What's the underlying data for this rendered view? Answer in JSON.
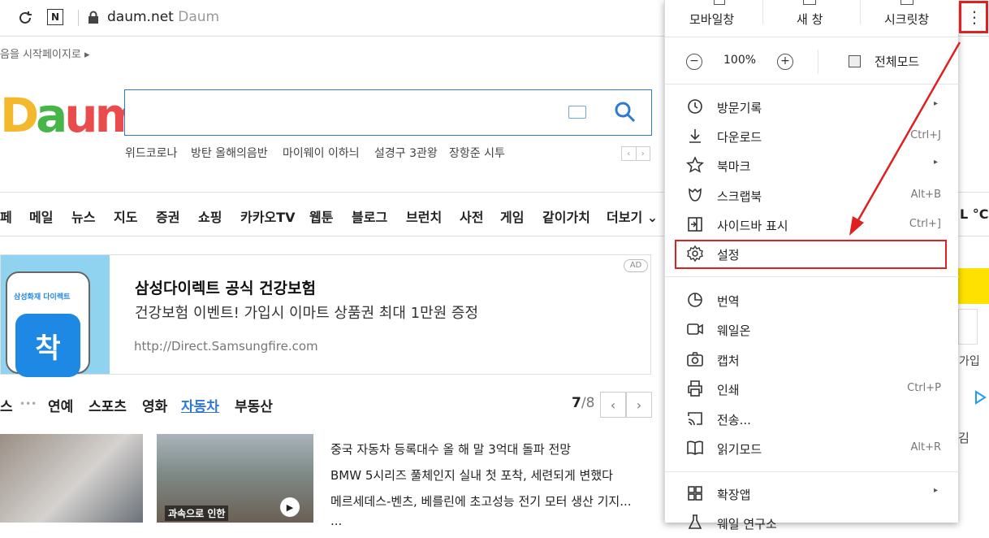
{
  "browser": {
    "domain": "daum.net",
    "site_name": "Daum",
    "reload_icon": "reload-icon",
    "n_icon": "N"
  },
  "daum": {
    "start_page_link": "음을 시작페이지로 ▸",
    "logo_text": [
      "D",
      "a",
      "u",
      "m"
    ],
    "keywords": [
      "위드코로나",
      "방탄 올해의음반",
      "마이웨이 이하늬",
      "설경구 3관왕",
      "장항준 시투"
    ],
    "paging": [
      "‹",
      "›"
    ],
    "nav": [
      "페",
      "메일",
      "뉴스",
      "지도",
      "증권",
      "쇼핑",
      "카카오TV",
      "웹툰",
      "블로그",
      "브런치",
      "사전",
      "게임",
      "같이가치",
      "더보기 ⌄"
    ],
    "weather": "L °C",
    "ad": {
      "badge_brand": "삼성화재 다이렉트",
      "badge": "착",
      "title": "삼성다이렉트 공식 건강보험",
      "subtitle": "건강보험 이벤트! 가입시 이마트 상품권 최대 1만원 증정",
      "url": "http://Direct.Samsungfire.com",
      "tag": "AD"
    },
    "tabs": [
      "스",
      "연예",
      "스포츠",
      "영화",
      "자동차",
      "부동산"
    ],
    "more_dots": "•••",
    "active_tab": "자동차",
    "counter_current": "7",
    "counter_total": "/8",
    "prev": "‹",
    "next": "›",
    "thumb_caption": "과속으로 인한",
    "news": [
      "중국 자동차 등록대수 올 해 말 3억대 돌파 전망",
      "BMW 5시리즈 풀체인지 실내 첫 포착, 세련되게 변했다",
      "메르세데스-벤츠, 베를린에 초고성능 전기 모터 생산 기지...",
      "..."
    ],
    "right_strip": [
      "가입",
      "김"
    ]
  },
  "menu": {
    "top": [
      "모바일창",
      "새 창",
      "시크릿창"
    ],
    "zoom": {
      "minus": "−",
      "value": "100%",
      "plus": "+",
      "fullscreen": "전체모드"
    },
    "items": [
      {
        "label": "방문기록",
        "shortcut": "",
        "arrow": "▸",
        "icon": "history-icon"
      },
      {
        "label": "다운로드",
        "shortcut": "Ctrl+J",
        "arrow": "",
        "icon": "download-icon"
      },
      {
        "label": "북마크",
        "shortcut": "",
        "arrow": "▸",
        "icon": "star-icon"
      },
      {
        "label": "스크랩북",
        "shortcut": "Alt+B",
        "arrow": "",
        "icon": "scrapbook-icon"
      },
      {
        "label": "사이드바 표시",
        "shortcut": "Ctrl+]",
        "arrow": "",
        "icon": "sidebar-icon"
      },
      {
        "label": "설정",
        "shortcut": "",
        "arrow": "",
        "icon": "gear-icon"
      },
      {
        "label": "번역",
        "shortcut": "",
        "arrow": "",
        "icon": "translate-icon"
      },
      {
        "label": "웨일온",
        "shortcut": "",
        "arrow": "",
        "icon": "video-icon"
      },
      {
        "label": "캡처",
        "shortcut": "",
        "arrow": "",
        "icon": "camera-icon"
      },
      {
        "label": "인쇄",
        "shortcut": "Ctrl+P",
        "arrow": "",
        "icon": "print-icon"
      },
      {
        "label": "전송...",
        "shortcut": "",
        "arrow": "",
        "icon": "cast-icon"
      },
      {
        "label": "읽기모드",
        "shortcut": "Alt+R",
        "arrow": "",
        "icon": "book-icon"
      },
      {
        "label": "확장앱",
        "shortcut": "",
        "arrow": "▸",
        "icon": "apps-icon"
      },
      {
        "label": "웨일 연구소",
        "shortcut": "",
        "arrow": "",
        "icon": "flask-icon"
      }
    ],
    "more_button": "⋮"
  },
  "colors": {
    "highlight": "#e02020",
    "daum_blue": "#2f79d6",
    "active_tab": "#2f79d6"
  }
}
